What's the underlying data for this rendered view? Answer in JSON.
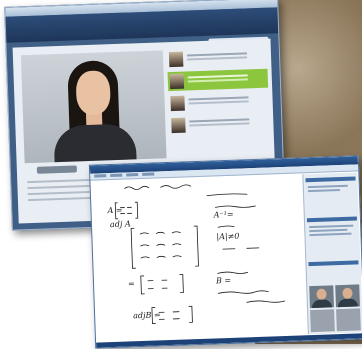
{
  "scene": {
    "background_photo": "textured brown photograph on the right edge",
    "colors": {
      "back_window_frame": "#3f5f86",
      "highlight_green": "#8cc63f",
      "front_window_chrome": "#1d4277",
      "ink": "#1a1a1a"
    }
  },
  "back_window": {
    "title": "",
    "header_label": "",
    "video_thumbnails_count": 4,
    "active_thumbnail_index": 1
  },
  "front_window": {
    "whiteboard": {
      "handwriting": [
        "A = [ 1 2 ; 3 4 ]",
        "adj A",
        "A⁻¹ = adj(A) / |A|",
        "|A| ≠ 0",
        "B = ( 1 2 ; 3 4 )"
      ]
    },
    "participant_videos": 4
  }
}
